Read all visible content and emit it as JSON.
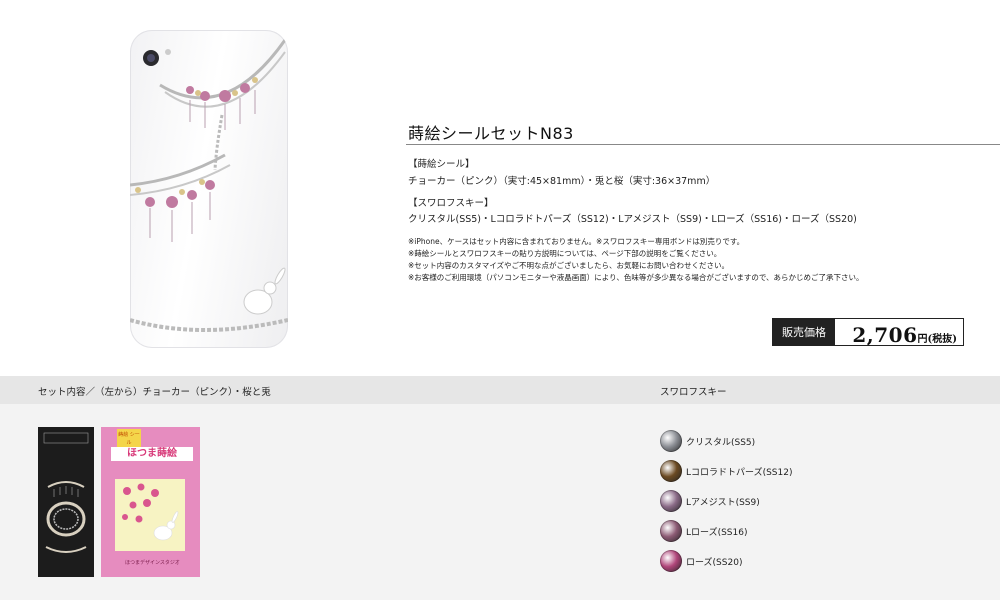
{
  "product": {
    "title": "蒔絵シールセットN83",
    "seal_label": "【蒔絵シール】",
    "seal_text": "チョーカー（ピンク）（実寸:45×81mm）・兎と桜（実寸:36×37mm）",
    "swarovski_label": "【スワロフスキー】",
    "swarovski_text": "クリスタル(SS5)・Lコロラドトパーズ（SS12)・Lアメジスト（SS9)・Lローズ（SS16)・ローズ（SS20)",
    "notes": [
      "※iPhone、ケースはセット内容に含まれておりません。※スワロフスキー専用ボンドは別売りです。",
      "※蒔絵シールとスワロフスキーの貼り方説明については、ページ下部の説明をご覧ください。",
      "※セット内容のカスタマイズやご不明な点がございましたら、お気軽にお問い合わせください。",
      "※お客様のご利用環境（パソコンモニターや液晶画面）により、色味等が多少異なる場合がございますので、あらかじめご了承下さい。"
    ]
  },
  "price": {
    "label": "販売価格",
    "amount": "2,706",
    "unit": "円(税抜)"
  },
  "set_contents": {
    "header": "セット内容／（左から）チョーカー（ピンク）・桜と兎",
    "package_tag": "蒔絵 シール",
    "package_name": "ほつま蒔絵",
    "package_foot": "ほつまデザインスタジオ"
  },
  "swarovski": {
    "header": "スワロフスキー",
    "items": [
      {
        "label": "クリスタル(SS5)",
        "color": "#8c8f95"
      },
      {
        "label": "Lコロラドトパーズ(SS12)",
        "color": "#6b4a22"
      },
      {
        "label": "Lアメジスト(SS9)",
        "color": "#8a6a87"
      },
      {
        "label": "Lローズ(SS16)",
        "color": "#8c5a74"
      },
      {
        "label": "ローズ(SS20)",
        "color": "#b0457a"
      }
    ]
  }
}
